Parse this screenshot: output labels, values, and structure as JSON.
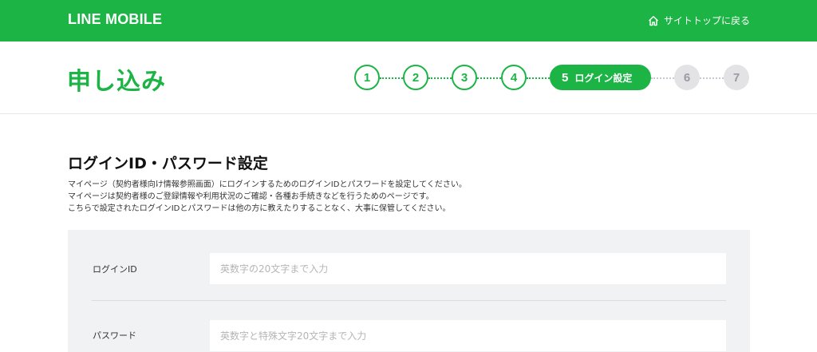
{
  "header": {
    "logo": "LINE MOBILE",
    "back_link": "サイトトップに戻る",
    "back_icon": "home-icon",
    "brand_color": "#1db446"
  },
  "page": {
    "title": "申し込み"
  },
  "stepper": {
    "steps": [
      {
        "number": "1",
        "state": "done"
      },
      {
        "number": "2",
        "state": "done"
      },
      {
        "number": "3",
        "state": "done"
      },
      {
        "number": "4",
        "state": "done"
      },
      {
        "number": "5",
        "label": "ログイン設定",
        "state": "current"
      },
      {
        "number": "6",
        "state": "todo"
      },
      {
        "number": "7",
        "state": "todo"
      }
    ]
  },
  "section": {
    "title": "ログインID・パスワード設定",
    "description": [
      "マイページ（契約者様向け情報参照画面）にログインするためのログインIDとパスワードを設定してください。",
      "マイページは契約者様のご登録情報や利用状況のご確認・各種お手続きなどを行うためのページです。",
      "こちらで設定されたログインIDとパスワードは他の方に教えたりすることなく、大事に保管してください。"
    ]
  },
  "form": {
    "login_id": {
      "label": "ログインID",
      "placeholder": "英数字の20文字まで入力",
      "value": ""
    },
    "password": {
      "label": "パスワード",
      "placeholder": "英数字と特殊文字20文字まで入力",
      "value": ""
    }
  }
}
